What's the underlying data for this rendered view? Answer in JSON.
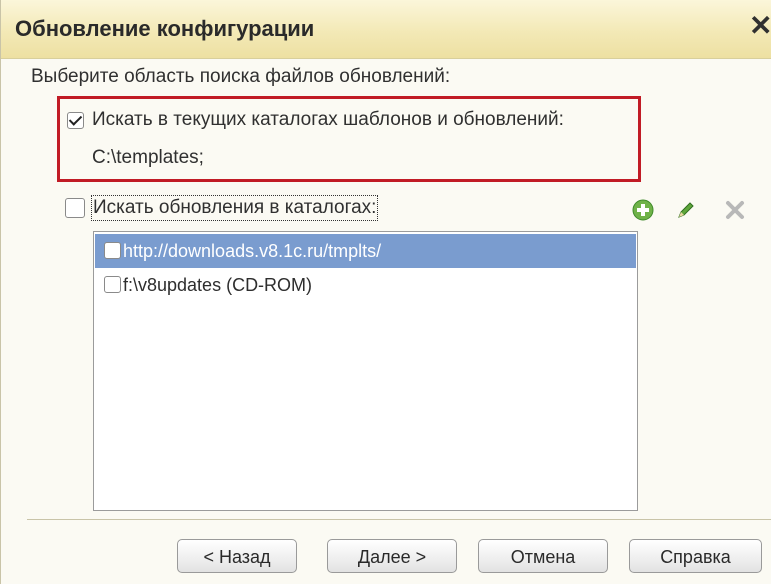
{
  "window": {
    "title": "Обновление конфигурации",
    "close_glyph": "✕"
  },
  "prompt": "Выберите область поиска файлов обновлений:",
  "option_current": {
    "label": "Искать в текущих каталогах шаблонов и обновлений:",
    "checked": true,
    "path": "C:\\templates;"
  },
  "option_catalogs": {
    "label": "Искать обновления в каталогах:",
    "checked": false
  },
  "toolbar": {
    "add_icon": "plus-circle-icon",
    "edit_icon": "pencil-icon",
    "delete_icon": "delete-x-icon"
  },
  "catalogs": [
    {
      "label": "http://downloads.v8.1c.ru/tmplts/",
      "checked": false,
      "selected": true
    },
    {
      "label": "f:\\v8updates (CD-ROM)",
      "checked": false,
      "selected": false
    }
  ],
  "buttons": {
    "back": "< Назад",
    "next": "Далее >",
    "cancel": "Отмена",
    "help": "Справка"
  },
  "colors": {
    "highlight_border": "#c11b25",
    "selection": "#7a9ccf",
    "titlebar": "#f3e9b6"
  }
}
